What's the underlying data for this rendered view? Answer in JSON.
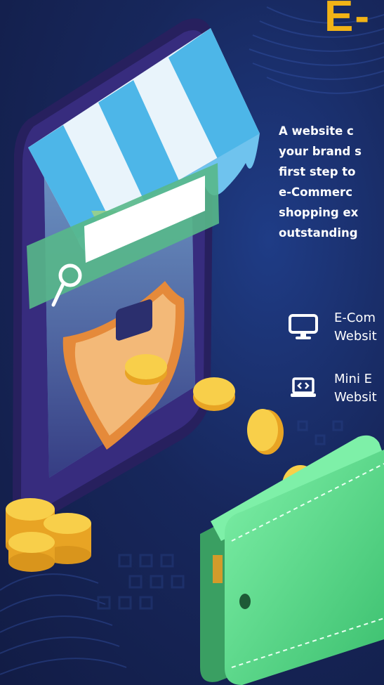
{
  "headline": "E-",
  "intro_lines": [
    "A website c",
    "your brand s",
    "first step to",
    "e-Commerc",
    "shopping ex",
    "outstanding"
  ],
  "services": [
    {
      "icon": "desktop-icon",
      "line1": "E-Com",
      "line2": "Websit"
    },
    {
      "icon": "laptop-code-icon",
      "line1": "Mini E",
      "line2": "Websit"
    }
  ],
  "colors": {
    "background": "#17275c",
    "headline": "#f2b316",
    "awning_blue": "#4db6e8",
    "coin_gold": "#f5c13a",
    "wallet_green": "#55d88a",
    "shield_orange": "#f0a656"
  }
}
